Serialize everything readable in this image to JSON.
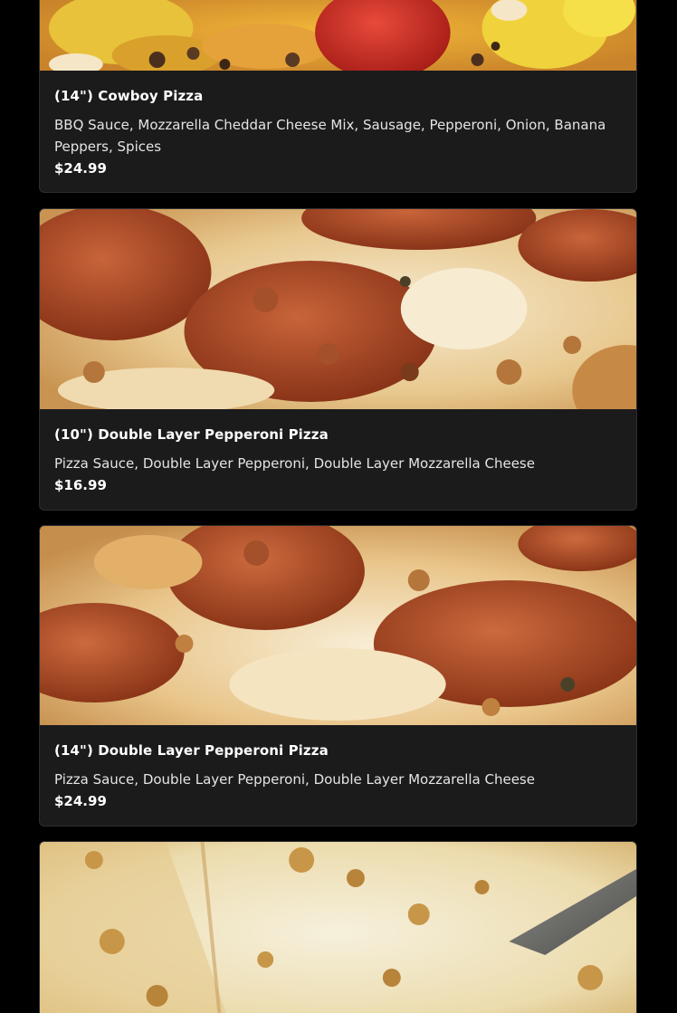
{
  "menu_items": [
    {
      "image": "pizza-photo-cowboy",
      "title": "(14\") Cowboy Pizza",
      "description": "BBQ Sauce, Mozzarella Cheddar Cheese Mix, Sausage, Pepperoni, Onion, Banana Peppers, Spices",
      "price": "$24.99"
    },
    {
      "image": "pizza-photo-double-pepperoni",
      "title": "(10\") Double Layer Pepperoni Pizza",
      "description": "Pizza Sauce, Double Layer Pepperoni, Double Layer Mozzarella Cheese",
      "price": "$16.99"
    },
    {
      "image": "pizza-photo-double-pepperoni",
      "title": "(14\") Double Layer Pepperoni Pizza",
      "description": "Pizza Sauce, Double Layer Pepperoni, Double Layer Mozzarella Cheese",
      "price": "$24.99"
    },
    {
      "image": "pizza-photo-cheese"
    }
  ],
  "colors": {
    "page_background": "#000000",
    "card_background": "#1b1b1c",
    "card_border": "#2e2e30",
    "title_text": "#ffffff",
    "description_text": "#e4e4e4"
  }
}
